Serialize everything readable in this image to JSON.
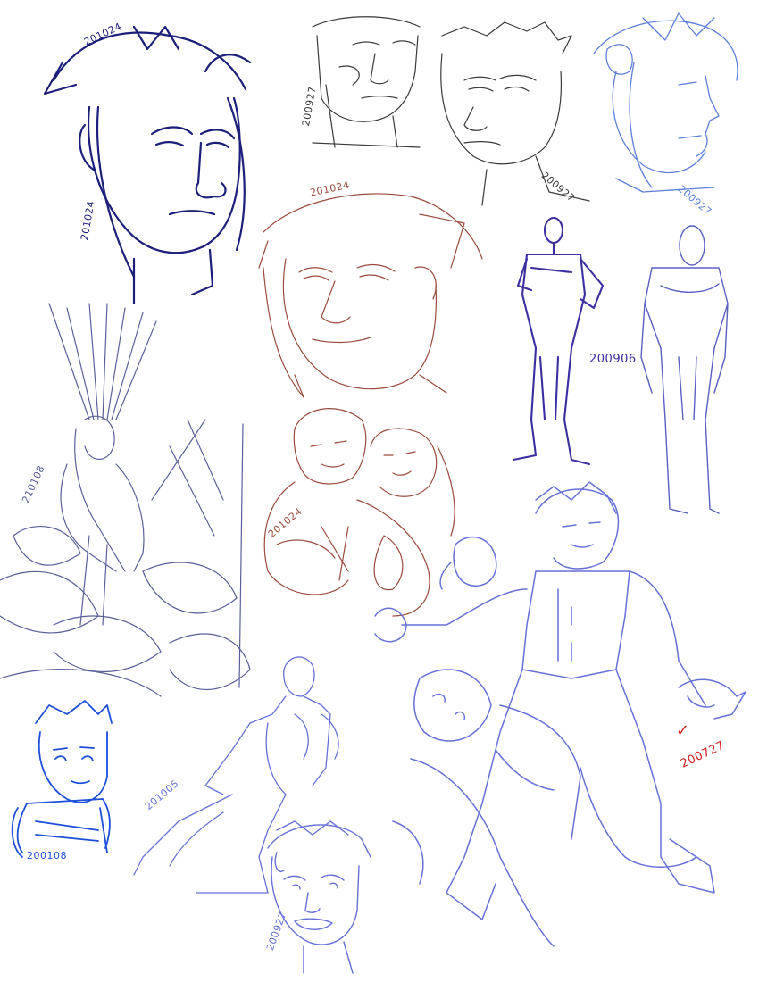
{
  "sheet": {
    "background": "#ffffff",
    "colors": {
      "navy": "#1c1f7a",
      "graphite": "#3a3a3a",
      "steel_blue": "#5d7fd8",
      "rust": "#9a4a3c",
      "violet": "#3b2fa0",
      "periwinkle": "#6670d6",
      "slate": "#8a8fb5",
      "bright_blue": "#1d4fd8",
      "red": "#d62020"
    }
  },
  "date_stamps": [
    {
      "id": "head-navy",
      "text": "201024",
      "color": "#1c1f7a"
    },
    {
      "id": "head-navy-side",
      "text": "201024",
      "color": "#1c1f7a"
    },
    {
      "id": "graphite-left",
      "text": "200927",
      "color": "#3a3a3a"
    },
    {
      "id": "graphite-right",
      "text": "200927",
      "color": "#3a3a3a"
    },
    {
      "id": "profile-blue",
      "text": "200927",
      "color": "#5d7fd8"
    },
    {
      "id": "rust-face",
      "text": "201024",
      "color": "#9a4a3c"
    },
    {
      "id": "standing-figure",
      "text": "200906",
      "color": "#3b2fa0"
    },
    {
      "id": "hanging-figure",
      "text": "210108",
      "color": "#5a5f9a"
    },
    {
      "id": "couple",
      "text": "201024",
      "color": "#9a4a3c"
    },
    {
      "id": "big-scene",
      "text": "200727",
      "color": "#d62020"
    },
    {
      "id": "armed-figure",
      "text": "200108",
      "color": "#1d4fd8"
    },
    {
      "id": "reclining-figure",
      "text": "201005",
      "color": "#6670d6"
    },
    {
      "id": "sweating-head",
      "text": "200927",
      "color": "#6670d6"
    }
  ],
  "checkmark": {
    "glyph": "✓",
    "color": "#d62020"
  },
  "sketch_subjects": [
    "head-navy-sketch-icon",
    "head-graphite-sketch-icon",
    "head-graphite-2-sketch-icon",
    "profile-head-sketch-icon",
    "rust-face-sketch-icon",
    "standing-figure-sketch-icon",
    "mannequin-figure-sketch-icon",
    "hanging-figure-sketch-icon",
    "couple-sketch-icon",
    "action-scene-sketch-icon",
    "armed-figure-sketch-icon",
    "reclining-figure-sketch-icon",
    "sweating-head-sketch-icon"
  ]
}
